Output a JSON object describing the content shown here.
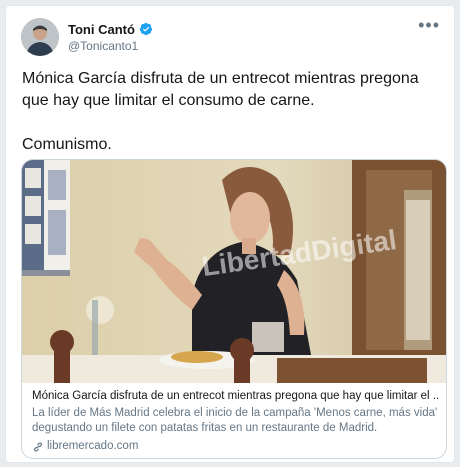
{
  "user": {
    "display_name": "Toni Cantó",
    "handle": "@Tonicanto1"
  },
  "tweet": {
    "line1": "Mónica García disfruta de un entrecot mientras pregona que hay que limitar el consumo de carne.",
    "line2": "Comunismo."
  },
  "card": {
    "title": "Mónica García disfruta de un entrecot mientras pregona que hay que limitar el ...",
    "description": "La líder de Más Madrid celebra el inicio de la campaña 'Menos carne, más vida' degustando un filete con patatas fritas en un restaurante de Madrid.",
    "domain": "libremercado.com",
    "watermark": "LibertadDigital"
  },
  "icons": {
    "verified": "verified-badge-icon",
    "more": "more-options-icon",
    "link": "link-icon"
  },
  "colors": {
    "accent": "#1da1f2",
    "text": "#14171a",
    "muted": "#657786",
    "border": "#ccd6dd"
  }
}
